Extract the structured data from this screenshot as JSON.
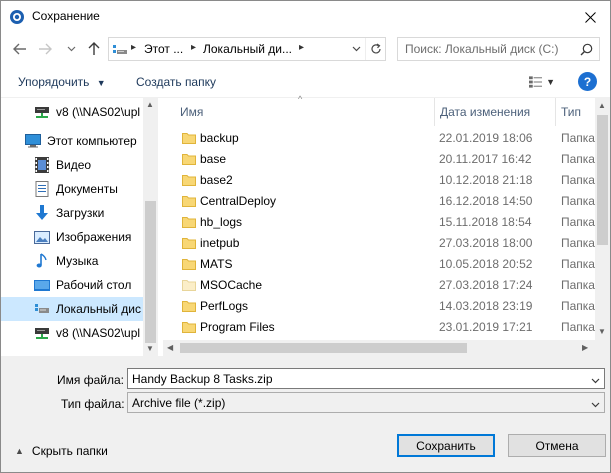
{
  "window": {
    "title": "Сохранение"
  },
  "address": {
    "segments": [
      "Этот ...",
      "Локальный ди..."
    ]
  },
  "search": {
    "placeholder": "Поиск: Локальный диск (C:)"
  },
  "toolbar": {
    "organize_label": "Упорядочить",
    "new_folder_label": "Создать папку",
    "help_label": "?"
  },
  "sidebar": {
    "items": [
      {
        "label": "v8 (\\\\NAS02\\upl",
        "icon": "network-drive-icon"
      },
      {
        "label": "Этот компьютер",
        "icon": "computer-icon"
      },
      {
        "label": "Видео",
        "icon": "video-folder-icon"
      },
      {
        "label": "Документы",
        "icon": "documents-folder-icon"
      },
      {
        "label": "Загрузки",
        "icon": "downloads-icon"
      },
      {
        "label": "Изображения",
        "icon": "pictures-folder-icon"
      },
      {
        "label": "Музыка",
        "icon": "music-icon"
      },
      {
        "label": "Рабочий стол",
        "icon": "desktop-folder-icon"
      },
      {
        "label": "Локальный дис",
        "icon": "local-disk-icon",
        "selected": true
      },
      {
        "label": "v8 (\\\\NAS02\\upl",
        "icon": "network-drive-icon"
      }
    ]
  },
  "file_list": {
    "columns": {
      "name": "Имя",
      "date": "Дата изменения",
      "type": "Тип"
    },
    "rows": [
      {
        "name": "backup",
        "date": "22.01.2019 18:06",
        "type": "Папка"
      },
      {
        "name": "base",
        "date": "20.11.2017 16:42",
        "type": "Папка"
      },
      {
        "name": "base2",
        "date": "10.12.2018 21:18",
        "type": "Папка"
      },
      {
        "name": "CentralDeploy",
        "date": "16.12.2018 14:50",
        "type": "Папка"
      },
      {
        "name": "hb_logs",
        "date": "15.11.2018 18:54",
        "type": "Папка"
      },
      {
        "name": "inetpub",
        "date": "27.03.2018 18:00",
        "type": "Папка"
      },
      {
        "name": "MATS",
        "date": "10.05.2018 20:52",
        "type": "Папка"
      },
      {
        "name": "MSOCache",
        "date": "27.03.2018 17:24",
        "type": "Папка",
        "hidden": true
      },
      {
        "name": "PerfLogs",
        "date": "14.03.2018 23:19",
        "type": "Папка"
      },
      {
        "name": "Program Files",
        "date": "23.01.2019 17:21",
        "type": "Папка"
      }
    ]
  },
  "form": {
    "filename_label": "Имя файла:",
    "filename_value": "Handy Backup 8 Tasks.zip",
    "filetype_label": "Тип файла:",
    "filetype_value": "Archive file (*.zip)"
  },
  "footer": {
    "hide_folders_label": "Скрыть папки",
    "save_label": "Сохранить",
    "cancel_label": "Отмена"
  },
  "colors": {
    "accent": "#0078d7",
    "selection": "#cce8ff",
    "folder": "#f8d775",
    "link_text": "#1e395b"
  }
}
